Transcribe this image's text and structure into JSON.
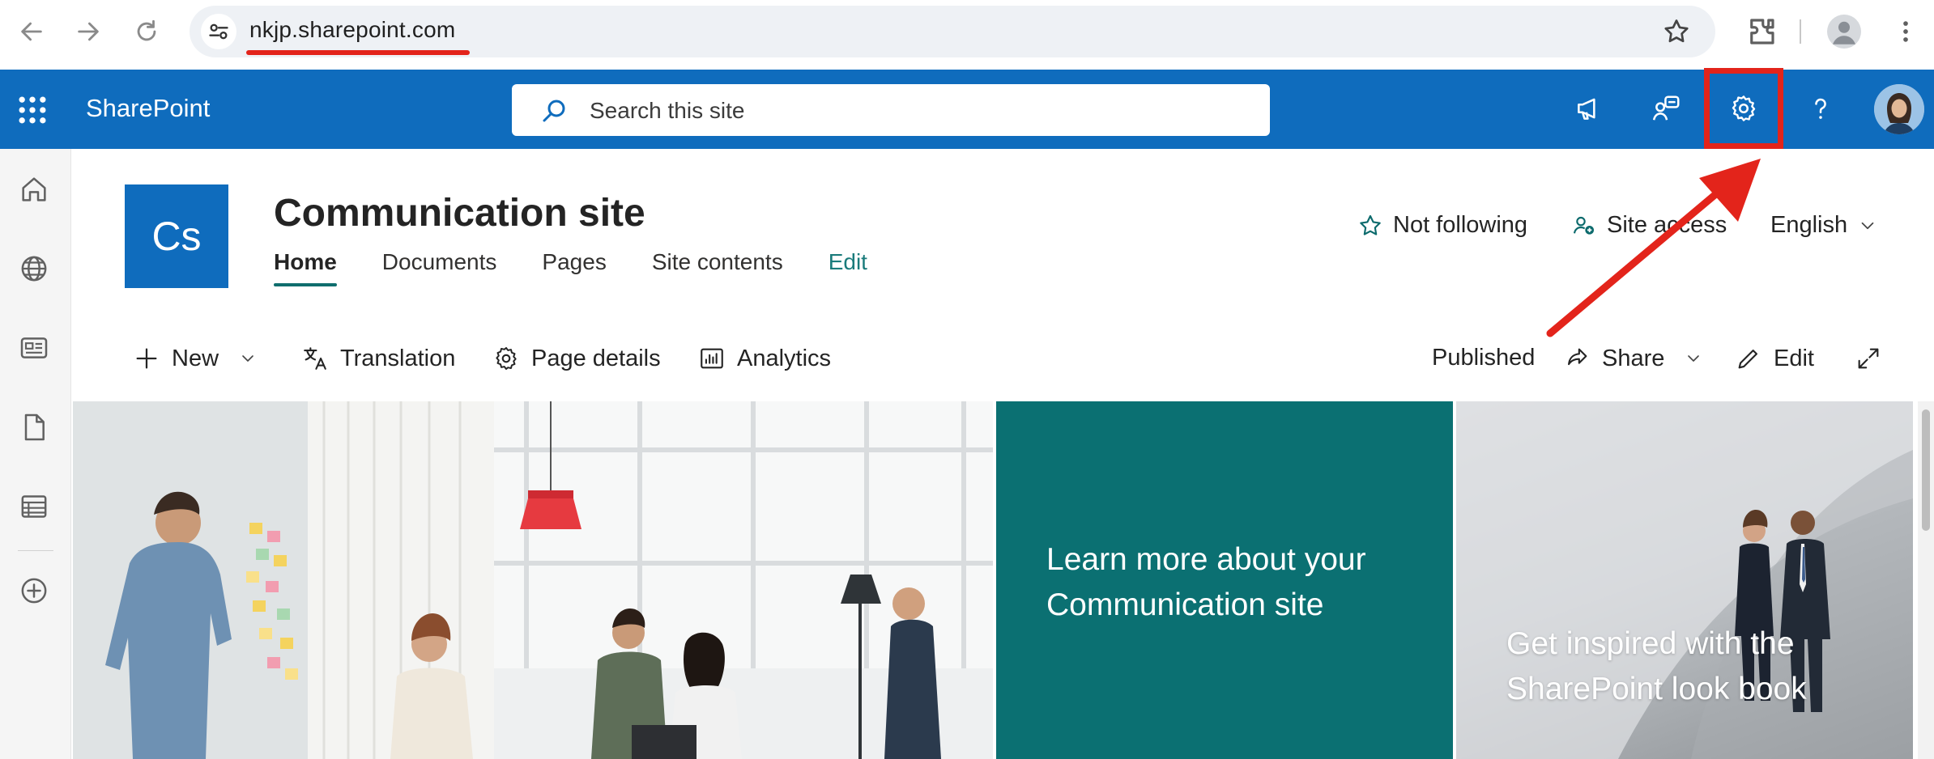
{
  "browser": {
    "url": "nkjp.sharepoint.com",
    "back_icon": "arrow-left-icon",
    "forward_icon": "arrow-right-icon",
    "reload_icon": "reload-icon"
  },
  "suitebar": {
    "brand": "SharePoint",
    "search_placeholder": "Search this site",
    "accent_color": "#0f6cbd"
  },
  "site": {
    "logo_initials": "Cs",
    "title": "Communication site",
    "nav": {
      "home": "Home",
      "documents": "Documents",
      "pages": "Pages",
      "site_contents": "Site contents",
      "edit": "Edit"
    },
    "actions": {
      "follow": "Not following",
      "site_access": "Site access",
      "language": "English"
    }
  },
  "commandbar": {
    "new": "New",
    "translation": "Translation",
    "page_details": "Page details",
    "analytics": "Analytics",
    "status": "Published",
    "share": "Share",
    "edit": "Edit"
  },
  "hero": {
    "tile_learn": "Learn more about your Communication site",
    "tile_lookbook": "Get inspired with the SharePoint look book",
    "teal_color": "#0b7072"
  },
  "annotation": {
    "highlight_color": "#e3241b",
    "target": "settings-gear"
  }
}
